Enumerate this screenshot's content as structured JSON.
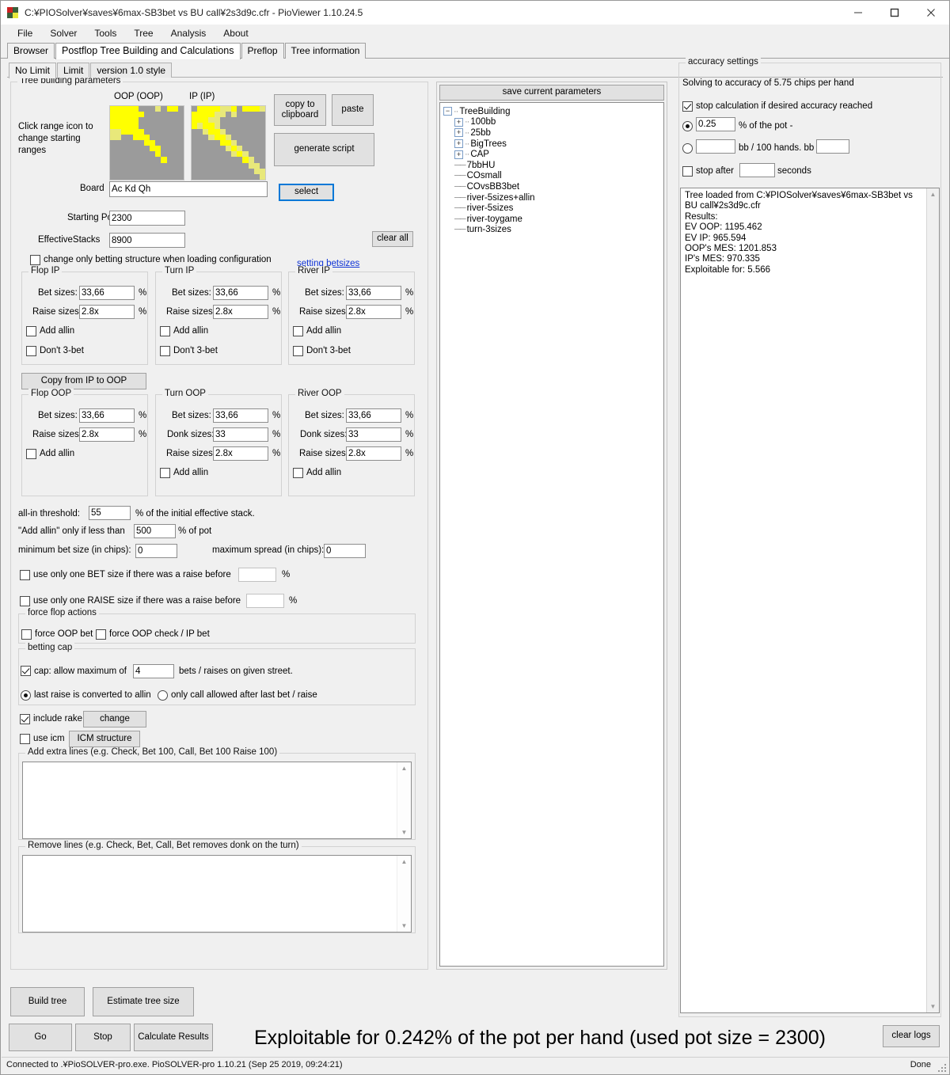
{
  "window": {
    "title": "C:¥PIOSolver¥saves¥6max-SB3bet vs BU call¥2s3d9c.cfr - PioViewer 1.10.24.5",
    "minimize": "—",
    "maximize": "❐",
    "close": "✕"
  },
  "menu": [
    "File",
    "Solver",
    "Tools",
    "Tree",
    "Analysis",
    "About"
  ],
  "main_tabs": [
    {
      "label": "Browser",
      "active": false
    },
    {
      "label": "Postflop Tree Building and Calculations",
      "active": true
    },
    {
      "label": "Preflop",
      "active": false
    },
    {
      "label": "Tree information",
      "active": false
    }
  ],
  "limit_tabs": [
    {
      "label": "No Limit",
      "active": true
    },
    {
      "label": "Limit",
      "active": false
    },
    {
      "label": "version 1.0 style",
      "active": false
    }
  ],
  "tree_building": {
    "legend": "Tree building parameters",
    "oop_label": "OOP (OOP)",
    "ip_label": "IP (IP)",
    "hint": "Click range icon to change starting ranges",
    "copy_to_clipboard": "copy to clipboard",
    "paste": "paste",
    "generate_script": "generate script",
    "board_label": "Board",
    "board_value": "Ac Kd Qh",
    "select_button": "select",
    "starting_pot_label": "Starting Pot:",
    "starting_pot_value": "2300",
    "effective_stacks_label": "EffectiveStacks",
    "effective_stacks_value": "8900",
    "clear_all": "clear all",
    "change_only_betting": "change only betting structure when loading configuration",
    "change_only_betting_checked": false,
    "setting_betsizes_link": "setting betsizes"
  },
  "betsizes": {
    "percent_suffix": "%",
    "copy_ip_to_oop": "Copy from IP to OOP",
    "labels": {
      "bet": "Bet sizes:",
      "raise": "Raise sizes:",
      "donk": "Donk sizes:",
      "add_allin": "Add allin",
      "dont_3bet": "Don't 3-bet"
    },
    "groups": [
      {
        "legend": "Flop IP",
        "bet": "33,66",
        "raise": "2.8x",
        "donk": null,
        "add_allin": false,
        "dont_3bet": false
      },
      {
        "legend": "Turn IP",
        "bet": "33,66",
        "raise": "2.8x",
        "donk": null,
        "add_allin": false,
        "dont_3bet": false
      },
      {
        "legend": "River IP",
        "bet": "33,66",
        "raise": "2.8x",
        "donk": null,
        "add_allin": false,
        "dont_3bet": false
      },
      {
        "legend": "Flop OOP",
        "bet": "33,66",
        "raise": "2.8x",
        "donk": null,
        "add_allin": false,
        "dont_3bet": null
      },
      {
        "legend": "Turn OOP",
        "bet": "33,66",
        "raise": "2.8x",
        "donk": "33",
        "add_allin": false,
        "dont_3bet": null
      },
      {
        "legend": "River OOP",
        "bet": "33,66",
        "raise": "2.8x",
        "donk": "33",
        "add_allin": false,
        "dont_3bet": null
      }
    ]
  },
  "thresholds": {
    "allin_threshold_label": "all-in threshold:",
    "allin_threshold_value": "55",
    "allin_threshold_suffix": "% of the initial effective stack.",
    "add_allin_less_prefix": "\"Add allin\" only if less than",
    "add_allin_less_value": "500",
    "add_allin_less_suffix": "% of pot",
    "min_bet_label": "minimum bet size (in chips):",
    "min_bet_value": "0",
    "max_spread_label": "maximum spread (in chips):",
    "max_spread_value": "0",
    "one_bet_label": "use only one BET size if there was a raise before",
    "one_bet_value": "",
    "one_bet_checked": false,
    "one_raise_label": "use only one RAISE size if there was a raise before",
    "one_raise_value": "",
    "one_raise_checked": false,
    "percent": "%"
  },
  "force_flop": {
    "legend": "force flop actions",
    "force_oop_bet": "force OOP bet",
    "force_oop_bet_checked": false,
    "force_oop_check_ip_bet": "force OOP check / IP bet",
    "force_oop_check_ip_bet_checked": false
  },
  "betting_cap": {
    "legend": "betting cap",
    "cap_label_prefix": "cap: allow maximum of",
    "cap_value": "4",
    "cap_label_suffix": "bets / raises on given street.",
    "cap_checked": true,
    "radio_last_raise": "last raise is converted to allin",
    "radio_only_call": "only call allowed after last bet / raise",
    "radio_selected": "last_raise"
  },
  "rake_icm": {
    "include_rake": "include rake",
    "include_rake_checked": true,
    "change_button": "change",
    "use_icm": "use icm",
    "use_icm_checked": false,
    "icm_structure_button": "ICM structure"
  },
  "lines": {
    "add_legend": "Add extra lines (e.g. Check, Bet 100, Call, Bet 100 Raise 100)",
    "add_value": "",
    "remove_legend": "Remove lines (e.g. Check, Bet, Call, Bet removes donk on the turn)",
    "remove_value": ""
  },
  "save_panel": {
    "button": "save current parameters",
    "tree": [
      {
        "label": "TreeBuilding",
        "depth": 0,
        "expander": "minus"
      },
      {
        "label": "100bb",
        "depth": 1,
        "expander": "plus"
      },
      {
        "label": "25bb",
        "depth": 1,
        "expander": "plus"
      },
      {
        "label": "BigTrees",
        "depth": 1,
        "expander": "plus"
      },
      {
        "label": "CAP",
        "depth": 1,
        "expander": "plus"
      },
      {
        "label": "7bbHU",
        "depth": 1,
        "expander": "none"
      },
      {
        "label": "COsmall",
        "depth": 1,
        "expander": "none"
      },
      {
        "label": "COvsBB3bet",
        "depth": 1,
        "expander": "none"
      },
      {
        "label": "river-5sizes+allin",
        "depth": 1,
        "expander": "none"
      },
      {
        "label": "river-5sizes",
        "depth": 1,
        "expander": "none"
      },
      {
        "label": "river-toygame",
        "depth": 1,
        "expander": "none"
      },
      {
        "label": "turn-3sizes",
        "depth": 1,
        "expander": "none"
      }
    ]
  },
  "accuracy": {
    "legend": "accuracy settings",
    "solving_to": "Solving to accuracy of 5.75 chips per hand",
    "stop_if_reached": "stop calculation if desired accuracy reached",
    "stop_if_reached_checked": true,
    "pot_percent_value": "0.25",
    "pot_percent_label": "% of the pot -",
    "pot_percent_selected": true,
    "bb_value": "",
    "bb_label": "bb / 100 hands. bb =",
    "bb_eq_value": "",
    "bb_selected": false,
    "stop_after_label": "stop after",
    "stop_after_value": "",
    "stop_after_suffix": "seconds",
    "stop_after_checked": false
  },
  "log": {
    "text": "Tree loaded from C:¥PIOSolver¥saves¥6max-SB3bet vs BU call¥2s3d9c.cfr\nResults:\nEV OOP: 1195.462\nEV IP: 965.594\nOOP's MES: 1201.853\nIP's MES: 970.335\nExploitable for: 5.566",
    "scroll_up": "⌃",
    "scroll_down": "⌄"
  },
  "bottom": {
    "build_tree": "Build tree",
    "estimate_tree_size": "Estimate tree size",
    "go": "Go",
    "stop": "Stop",
    "calculate_results": "Calculate Results",
    "exploitable_text": "Exploitable for 0.242% of the pot per hand (used pot size = 2300)",
    "clear_logs": "clear logs"
  },
  "statusbar": {
    "left": "Connected to .¥PioSOLVER-pro.exe. PioSOLVER-pro 1.10.21 (Sep 25 2019, 09:24:21)",
    "right": "Done"
  },
  "colors": {
    "range_selected": "#ffff00",
    "range_partial": "#e8e87a",
    "range_empty": "#9b9b9b",
    "link": "#1034d6",
    "focus": "#0078d7"
  },
  "ranges": {
    "oop": [
      [
        2,
        2,
        2,
        2,
        2,
        0,
        0,
        0,
        1,
        0,
        2,
        2,
        0
      ],
      [
        2,
        2,
        2,
        2,
        2,
        2,
        0,
        0,
        0,
        0,
        0,
        0,
        0
      ],
      [
        2,
        2,
        2,
        2,
        2,
        0,
        0,
        0,
        0,
        0,
        0,
        0,
        0
      ],
      [
        2,
        2,
        2,
        2,
        2,
        0,
        0,
        0,
        0,
        0,
        0,
        0,
        0
      ],
      [
        1,
        1,
        2,
        2,
        2,
        2,
        0,
        0,
        0,
        0,
        0,
        0,
        0
      ],
      [
        1,
        1,
        0,
        0,
        2,
        2,
        2,
        0,
        0,
        0,
        0,
        0,
        0
      ],
      [
        0,
        0,
        0,
        0,
        0,
        0,
        2,
        2,
        0,
        0,
        0,
        0,
        0
      ],
      [
        0,
        0,
        0,
        0,
        0,
        0,
        0,
        2,
        2,
        0,
        0,
        0,
        0
      ],
      [
        0,
        0,
        0,
        0,
        0,
        0,
        0,
        0,
        2,
        0,
        0,
        0,
        0
      ],
      [
        0,
        0,
        0,
        0,
        0,
        0,
        0,
        0,
        0,
        2,
        0,
        0,
        0
      ],
      [
        0,
        0,
        0,
        0,
        0,
        0,
        0,
        0,
        0,
        0,
        0,
        0,
        0
      ],
      [
        0,
        0,
        0,
        0,
        0,
        0,
        0,
        0,
        0,
        0,
        0,
        0,
        0
      ],
      [
        0,
        0,
        0,
        0,
        0,
        0,
        0,
        0,
        0,
        0,
        0,
        0,
        0
      ]
    ],
    "ip": [
      [
        0,
        2,
        2,
        2,
        2,
        1,
        1,
        2,
        0,
        2,
        2,
        2,
        1
      ],
      [
        2,
        2,
        2,
        2,
        1,
        1,
        0,
        1,
        0,
        0,
        0,
        0,
        0
      ],
      [
        2,
        2,
        2,
        1,
        1,
        0,
        0,
        0,
        0,
        0,
        0,
        0,
        0
      ],
      [
        2,
        1,
        2,
        2,
        1,
        0,
        0,
        0,
        0,
        0,
        0,
        0,
        0
      ],
      [
        0,
        0,
        1,
        2,
        2,
        1,
        0,
        0,
        0,
        0,
        0,
        0,
        0
      ],
      [
        0,
        0,
        0,
        1,
        2,
        2,
        1,
        0,
        0,
        0,
        0,
        0,
        0
      ],
      [
        0,
        0,
        0,
        0,
        0,
        2,
        2,
        1,
        0,
        0,
        0,
        0,
        0
      ],
      [
        0,
        0,
        0,
        0,
        0,
        0,
        1,
        2,
        1,
        0,
        0,
        0,
        0
      ],
      [
        0,
        0,
        0,
        0,
        0,
        0,
        0,
        1,
        2,
        1,
        0,
        0,
        0
      ],
      [
        0,
        0,
        0,
        0,
        0,
        0,
        0,
        0,
        0,
        2,
        1,
        0,
        0
      ],
      [
        0,
        0,
        0,
        0,
        0,
        0,
        0,
        0,
        0,
        0,
        1,
        1,
        0
      ],
      [
        0,
        0,
        0,
        0,
        0,
        0,
        0,
        0,
        0,
        0,
        0,
        1,
        1
      ],
      [
        0,
        0,
        0,
        0,
        0,
        0,
        0,
        0,
        0,
        0,
        0,
        0,
        1
      ]
    ]
  }
}
